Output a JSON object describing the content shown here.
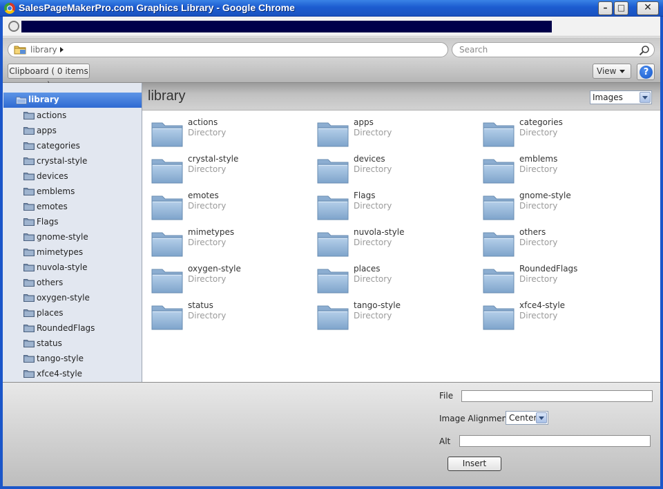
{
  "window": {
    "title": "SalesPageMakerPro.com Graphics Library - Google Chrome",
    "minimize": "–",
    "maximize": "□",
    "close": "✕"
  },
  "address_bar": {
    "url": " "
  },
  "toolbar": {
    "location": "library",
    "search_placeholder": "Search",
    "clipboard_label": "Clipboard ( 0 items )",
    "view_label": "View",
    "help_label": "?"
  },
  "sidebar": {
    "root": "library",
    "items": [
      "actions",
      "apps",
      "categories",
      "crystal-style",
      "devices",
      "emblems",
      "emotes",
      "Flags",
      "gnome-style",
      "mimetypes",
      "nuvola-style",
      "others",
      "oxygen-style",
      "places",
      "RoundedFlags",
      "status",
      "tango-style",
      "xfce4-style"
    ]
  },
  "content": {
    "title": "library",
    "filter_selected": "Images",
    "type_label": "Directory",
    "folders": [
      "actions",
      "apps",
      "categories",
      "crystal-style",
      "devices",
      "emblems",
      "emotes",
      "Flags",
      "gnome-style",
      "mimetypes",
      "nuvola-style",
      "others",
      "oxygen-style",
      "places",
      "RoundedFlags",
      "status",
      "tango-style",
      "xfce4-style"
    ]
  },
  "footer": {
    "file_label": "File",
    "file_value": "",
    "alignment_label": "Image Alignment",
    "alignment_selected": "Center",
    "alt_label": "Alt",
    "alt_value": "",
    "insert_label": "Insert"
  },
  "colors": {
    "title_bar": "#1c5cd0",
    "selection": "#2f6ad2",
    "folder_blue": "#8fb3d6"
  }
}
